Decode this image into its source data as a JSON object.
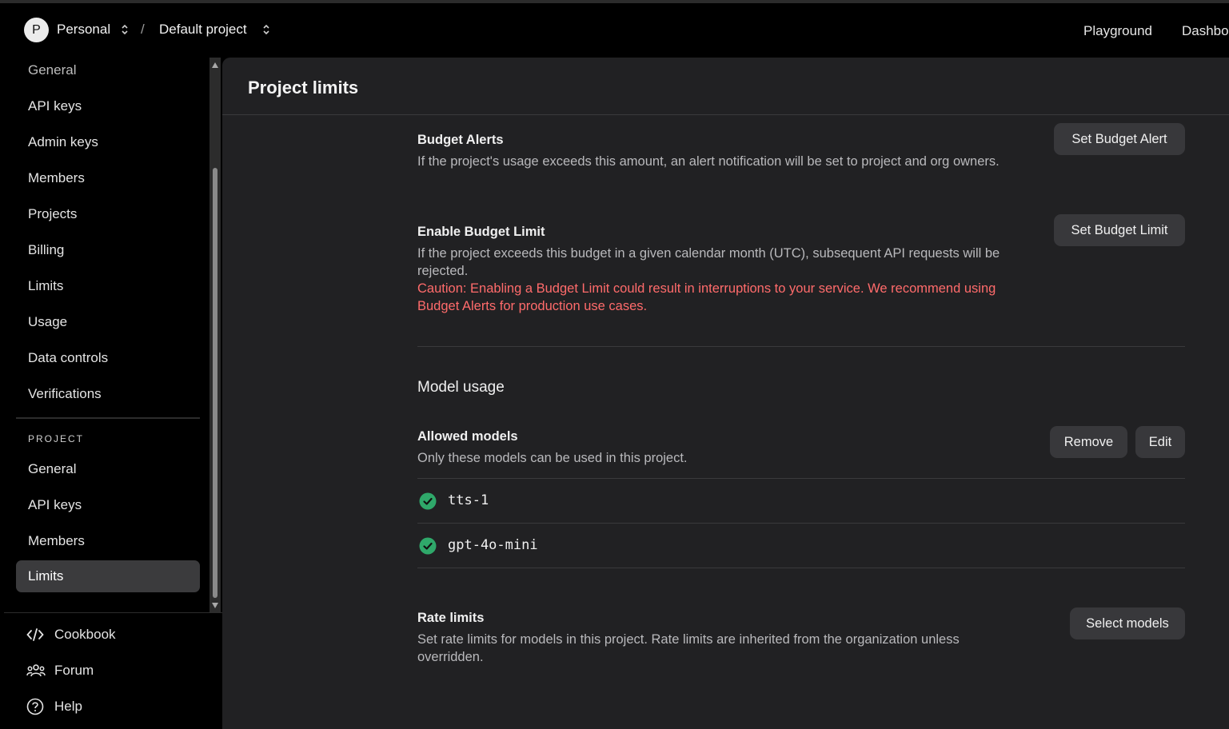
{
  "topbar": {
    "avatar_letter": "P",
    "org_name": "Personal",
    "separator": "/",
    "project_name": "Default project",
    "links": [
      "Playground",
      "Dashbo"
    ]
  },
  "sidebar": {
    "org_items": [
      "General",
      "API keys",
      "Admin keys",
      "Members",
      "Projects",
      "Billing",
      "Limits",
      "Usage",
      "Data controls",
      "Verifications"
    ],
    "project_section_label": "PROJECT",
    "project_items": [
      "General",
      "API keys",
      "Members",
      "Limits"
    ],
    "active_project_item": "Limits",
    "footer": {
      "cookbook": "Cookbook",
      "forum": "Forum",
      "help": "Help"
    }
  },
  "main": {
    "title": "Project limits",
    "budget_alerts": {
      "title": "Budget Alerts",
      "description": "If the project's usage exceeds this amount, an alert notification will be set to project and org owners.",
      "button": "Set Budget Alert"
    },
    "budget_limit": {
      "title": "Enable Budget Limit",
      "description": "If the project exceeds this budget in a given calendar month (UTC), subsequent API requests will be rejected.",
      "caution": "Caution: Enabling a Budget Limit could result in interruptions to your service. We recommend using Budget Alerts for production use cases.",
      "button": "Set Budget Limit"
    },
    "model_usage": {
      "title": "Model usage",
      "allowed_title": "Allowed models",
      "allowed_description": "Only these models can be used in this project.",
      "remove_button": "Remove",
      "edit_button": "Edit",
      "models": [
        "tts-1",
        "gpt-4o-mini"
      ]
    },
    "rate_limits": {
      "title": "Rate limits",
      "description": "Set rate limits for models in this project. Rate limits are inherited from the organization unless overridden.",
      "button": "Select models"
    }
  },
  "colors": {
    "background": "#000000",
    "panel": "#212123",
    "button": "#38383b",
    "active_nav": "#3b3b3d",
    "warning": "#ff6b6b",
    "check": "#2fa86a"
  }
}
